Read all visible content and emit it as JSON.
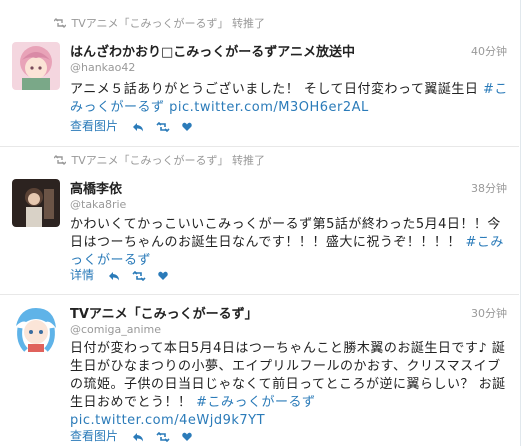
{
  "tweets": [
    {
      "retweet_source": "TVアニメ「こみっくがーるず」",
      "retweet_label": "转推了",
      "name": "はんざわかおり□こみっくがーるずアニメ放送中",
      "handle": "@hankao42",
      "time": "40分钟",
      "text_main": "アニメ５話ありがとうございました！ そして日付変わって翼誕生日 ",
      "text_tag": "#こみっくがーるず",
      "text_link": " pic.twitter.com/M3OH6er2AL",
      "action_label": "查看图片"
    },
    {
      "retweet_source": "TVアニメ「こみっくがーるず」",
      "retweet_label": "转推了",
      "name": "高橋李依",
      "handle": "@taka8rie",
      "time": "38分钟",
      "text_main": "かわいくてかっこいいこみっくがーるず第5話が終わった5月4日！！今日はつーちゃんのお誕生日なんです！！！盛大に祝うぞ！！！！ ",
      "text_tag": "#こみっくがーるず",
      "text_link": "",
      "action_label": "详情"
    },
    {
      "retweet_source": "",
      "retweet_label": "",
      "name": "TVアニメ「こみっくがーるず」",
      "handle": "@comiga_anime",
      "time": "30分钟",
      "text_main": "日付が変わって本日5月4日はつーちゃんこと勝木翼のお誕生日です♪ 誕生日がひなまつりの小夢、エイプリルフールのかおす、クリスマスイブの琉姫。子供の日当日じゃなくて前日ってところが逆に翼らしい？ お誕生日おめでとう！！ ",
      "text_tag": "#こみっくがーるず",
      "text_link": " pic.twitter.com/4eWjd9k7YT",
      "action_label": "查看图片"
    }
  ],
  "icons": {
    "retweet_marker": "retweet-icon",
    "reply": "reply-icon",
    "retweet": "retweet-icon",
    "favorite": "heart-icon"
  },
  "colors": {
    "link": "#2b7bb9",
    "muted": "#999999",
    "text": "#222222"
  }
}
